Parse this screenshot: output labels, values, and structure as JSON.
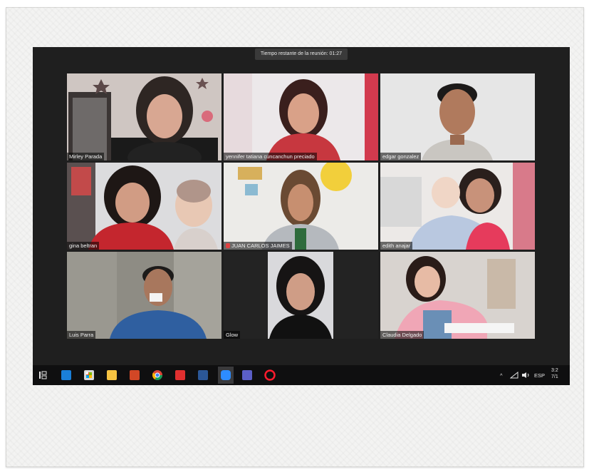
{
  "meeting": {
    "timer_text": "Tiempo restante de la reunión: 01:27"
  },
  "participants": [
    {
      "name": "Mirley Parada",
      "active": false
    },
    {
      "name": "yennifer tatiana cuncanchun preciado",
      "active": false
    },
    {
      "name": "edgar gonzalez",
      "active": false
    },
    {
      "name": "gina beltran",
      "active": false
    },
    {
      "name": "JUAN CARLOS JAIMES",
      "active": false,
      "muted": true
    },
    {
      "name": "edith anajar",
      "active": false
    },
    {
      "name": "Luis Parra",
      "active": true
    },
    {
      "name": "Glow",
      "active": false
    },
    {
      "name": "Claudia Delgado",
      "active": false
    }
  ],
  "taskbar": {
    "apps": [
      "task-view",
      "mail",
      "store",
      "file-explorer",
      "powerpoint",
      "chrome",
      "acrobat",
      "word",
      "zoom",
      "teams",
      "opera"
    ],
    "tray": {
      "chevron": "^",
      "language": "ESP",
      "time": "3:2",
      "date": "7/1"
    }
  },
  "colors": {
    "screen_bg": "#1f1f1f",
    "active_speaker_border": "#d9e27a",
    "taskbar_bg": "#0f0f10"
  }
}
